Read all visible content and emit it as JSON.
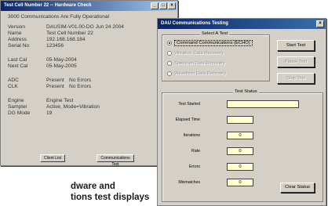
{
  "back_window": {
    "title": "Test Cell Number 22 -- Hardware Check",
    "title_buttons": [
      "_",
      "□",
      "×"
    ],
    "header": "3000 Communications Are Fully Operational",
    "rows": [
      {
        "label": "Version",
        "value": "DAUSIM-V01.00-DG  Jun 24 2004"
      },
      {
        "label": "Name",
        "value": "Test Cell Number 22"
      },
      {
        "label": "Address",
        "value": "192.168.168.184"
      },
      {
        "label": "Serial No",
        "value": "123456"
      }
    ],
    "cal_rows": [
      {
        "label": "Last Cal",
        "value": "05-May-2004"
      },
      {
        "label": "Next Cal",
        "value": "05-May-2005"
      }
    ],
    "hw_rows": [
      {
        "label": "ADC",
        "value": "Present",
        "status": "No Errors"
      },
      {
        "label": "CLK",
        "value": "Present",
        "status": "No Errors"
      }
    ],
    "engine_rows": [
      {
        "label": "Engine",
        "value": "Engine Test"
      },
      {
        "label": "Sampler",
        "value": "Active, Mode=Vibration"
      },
      {
        "label": "DG Mode",
        "value": "19"
      }
    ],
    "buttons": {
      "client_list": "Client List",
      "comm_test": "Communications Test"
    }
  },
  "front_window": {
    "title": "DAU Communications Testing",
    "close": "×",
    "select_group": "Select A Test",
    "tests": [
      {
        "label": "Command Communications (ECHO)",
        "selected": true,
        "enabled": true
      },
      {
        "label": "Vibration Data Recovery",
        "selected": false,
        "enabled": false
      },
      {
        "label": "Spectrum Data Recovery",
        "selected": false,
        "enabled": false
      },
      {
        "label": "Waveform Data Recovery",
        "selected": false,
        "enabled": false
      }
    ],
    "buttons": {
      "start": "Start Test",
      "pause": "Pause Test",
      "stop": "Stop Test",
      "clear": "Clear Status"
    },
    "status_group": "Test Status",
    "status": [
      {
        "label": "Test Started",
        "value": ""
      },
      {
        "label": "Elapsed Time",
        "value": ""
      },
      {
        "label": "Iterations",
        "value": "0"
      },
      {
        "label": "Rate",
        "value": "0"
      },
      {
        "label": "Errors",
        "value": "0"
      },
      {
        "label": "Mismatches",
        "value": "0"
      }
    ]
  },
  "caption": {
    "line1": "dware and",
    "line2": "tions test displays"
  }
}
